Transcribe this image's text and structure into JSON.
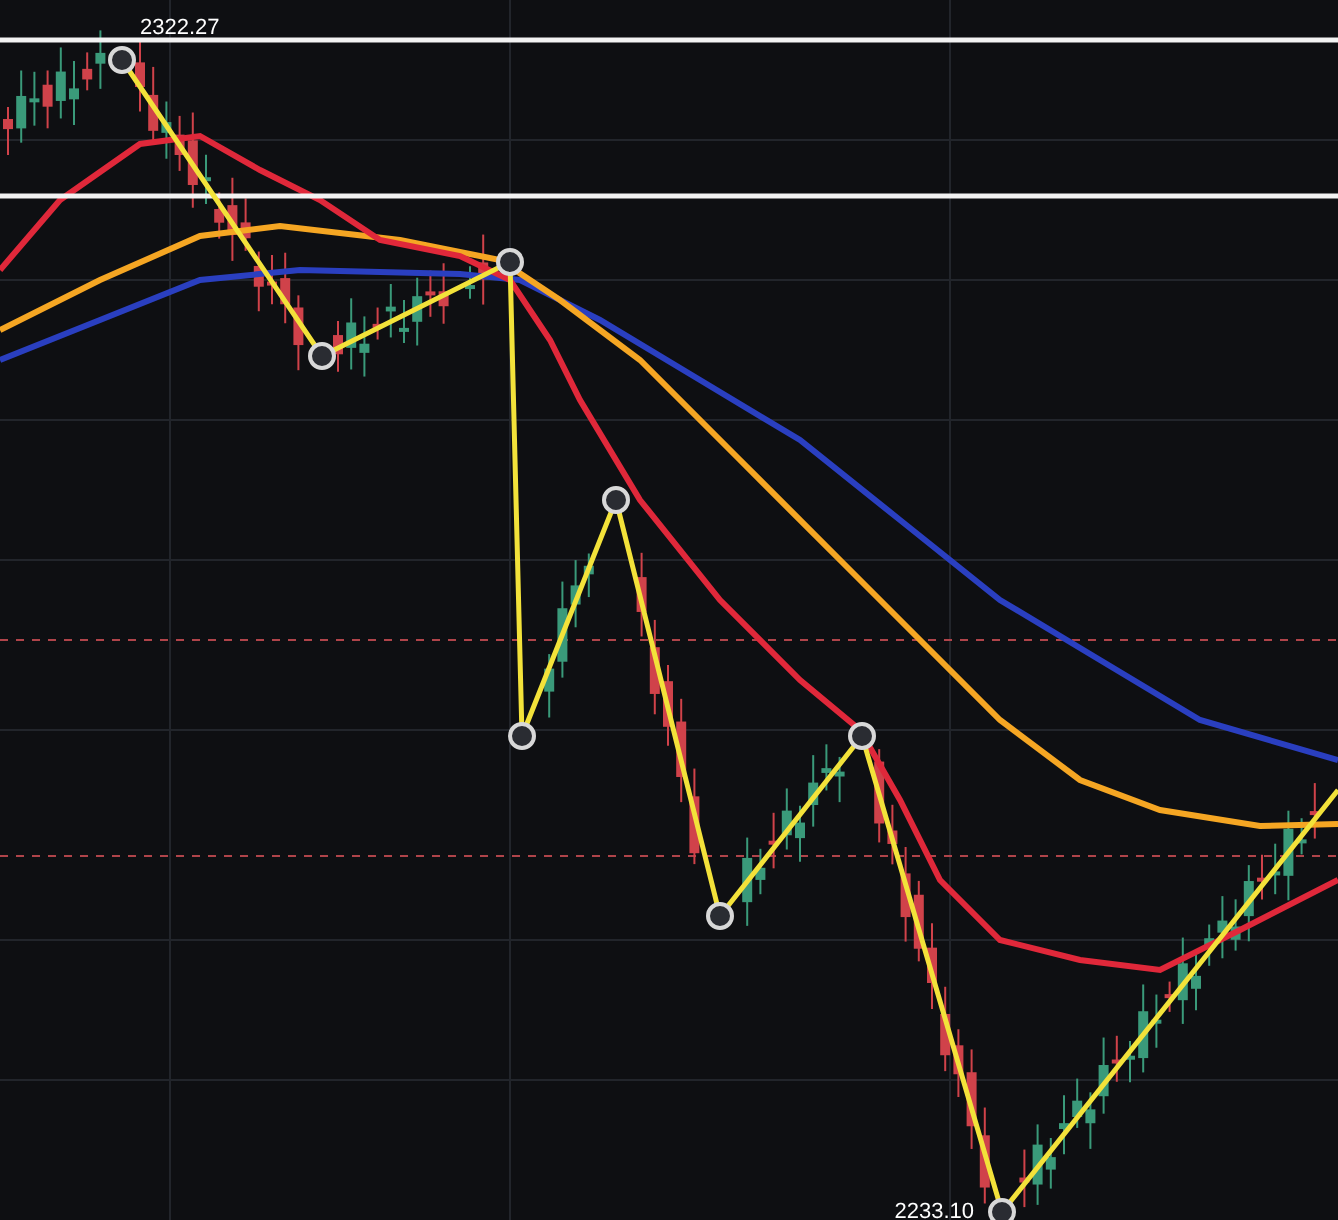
{
  "chart": {
    "price_labels": [
      {
        "kind": "high",
        "text": "2322.27"
      },
      {
        "kind": "low",
        "text": "2233.10"
      }
    ]
  }
}
